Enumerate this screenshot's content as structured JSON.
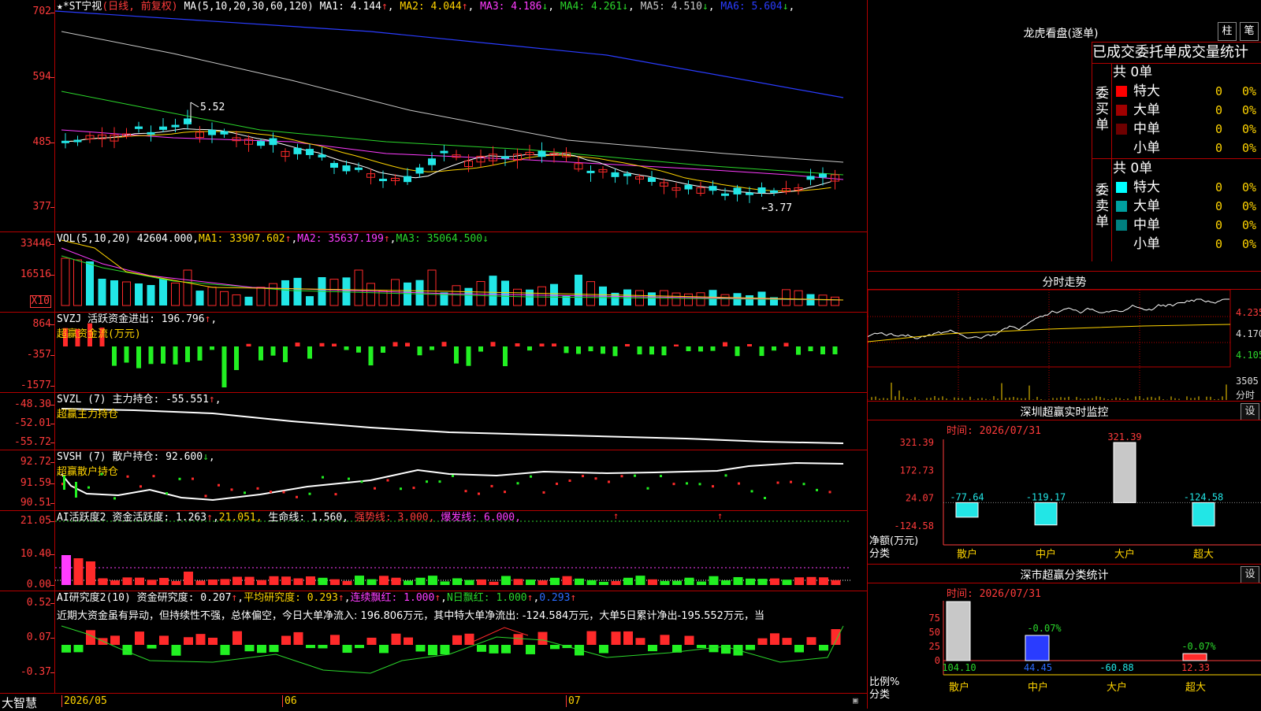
{
  "main": {
    "title_stock": "★*ST宁视",
    "title_mode": "(日线, 前复权)",
    "ma_label": "MA(5,10,20,30,60,120)",
    "ma": [
      {
        "name": "MA1: 4.144",
        "arrow": "↑",
        "color": "#ffffff"
      },
      {
        "name": "MA2: 4.044",
        "arrow": "↑",
        "color": "#ffd400"
      },
      {
        "name": "MA3: 4.186",
        "arrow": "↓",
        "color": "#ff3cff"
      },
      {
        "name": "MA4: 4.261",
        "arrow": "↓",
        "color": "#2bd62b"
      },
      {
        "name": "MA5: 4.510",
        "arrow": "↓",
        "color": "#c8c8c8"
      },
      {
        "name": "MA6: 5.604",
        "arrow": "↓",
        "color": "#2a3cff"
      }
    ],
    "yticks": [
      "702",
      "594",
      "485",
      "377"
    ],
    "high_label": "5.52",
    "low_label": "3.77"
  },
  "volume": {
    "label": "VOL(5,10,20)",
    "value": "42604.000",
    "ma1": "MA1: 33907.602",
    "ma2": "MA2: 35637.199",
    "ma3": "MA3: 35064.500",
    "yticks": [
      "33446",
      "16516"
    ],
    "unit": "X10"
  },
  "svzj": {
    "label": "SVZJ",
    "text": "活跃资金进出: 196.796",
    "subtitle": "超赢资金流(万元)",
    "yticks": [
      "864",
      "-357",
      "-1577"
    ]
  },
  "svzl": {
    "label": "SVZL (7)",
    "text": "主力持仓: -55.551",
    "subtitle": "超赢主力持仓",
    "yticks": [
      "-48.30",
      "-52.01",
      "-55.72"
    ]
  },
  "svsh": {
    "label": "SVSH (7)",
    "text": "散户持仓: 92.600",
    "subtitle": "超赢散户持仓",
    "yticks": [
      "92.72",
      "91.59",
      "90.51"
    ]
  },
  "ai_active": {
    "label": "AI活跃度2",
    "t1": "资金活跃度: 1.263",
    "t2": "21.051,",
    "t3": "生命线: 1.560,",
    "t4": "强势线: 3.000,",
    "t5": "爆发线: 6.000,",
    "yticks": [
      "21.05",
      "10.40",
      "0.00"
    ]
  },
  "ai_research": {
    "label": "AI研究度2(10)",
    "t1": "资金研究度: 0.207",
    "t2": "平均研究度: 0.293",
    "t3": "连续飘红: 1.000",
    "t4": "N日飘红: 1.000",
    "t5": "0.293",
    "comment": "近期大资金虽有异动，但持续性不强，总体偏空，今日大单净流入: 196.806万元，其中特大单净流出: -124.584万元，大单5日累计净出-195.552万元，当",
    "yticks": [
      "0.52",
      "0.07",
      "-0.37"
    ]
  },
  "dates": {
    "logo": "大智慧",
    "labels": [
      "2026/05",
      "06",
      "07"
    ]
  },
  "longhu": {
    "title": "龙虎看盘(逐单)",
    "btn_zhu": "柱",
    "btn_bi": "笔",
    "header": "已成交委托单成交量统计",
    "buy_label": "委买单",
    "sell_label": "委卖单",
    "buy_total": "共 0单",
    "sell_total": "共 0单",
    "buy_rows": [
      {
        "name": "特大",
        "qty": "0",
        "pct": "0%",
        "color": "#ff0000"
      },
      {
        "name": "大单",
        "qty": "0",
        "pct": "0%",
        "color": "#a00000"
      },
      {
        "name": "中单",
        "qty": "0",
        "pct": "0%",
        "color": "#6e0000"
      },
      {
        "name": "小单",
        "qty": "0",
        "pct": "0%",
        "color": ""
      }
    ],
    "sell_rows": [
      {
        "name": "特大",
        "qty": "0",
        "pct": "0%",
        "color": "#00ffff"
      },
      {
        "name": "大单",
        "qty": "0",
        "pct": "0%",
        "color": "#00a0a0"
      },
      {
        "name": "中单",
        "qty": "0",
        "pct": "0%",
        "color": "#008080"
      },
      {
        "name": "小单",
        "qty": "0",
        "pct": "0%",
        "color": ""
      }
    ]
  },
  "intraday": {
    "title": "分时走势",
    "yticks": [
      "4.235",
      "4.170",
      "4.105"
    ],
    "vol_label": "3505",
    "vol_unit": "分时"
  },
  "monitor": {
    "title": "深圳超赢实时监控",
    "gear": "设",
    "time": "时间: 2026/07/31",
    "yticks": [
      "321.39",
      "172.73",
      "24.07",
      "-124.58"
    ],
    "ylabel": "净额(万元)",
    "xlabel": "分类",
    "categories": [
      "散户",
      "中户",
      "大户",
      "超大"
    ],
    "values": [
      "-77.64",
      "-119.17",
      "321.39",
      "-124.58"
    ]
  },
  "classify": {
    "title": "深市超赢分类统计",
    "gear": "设",
    "time": "时间: 2026/07/31",
    "yticks": [
      "75",
      "50",
      "25",
      "0"
    ],
    "ylabel": "比例%",
    "xlabel": "分类",
    "categories": [
      "散户",
      "中户",
      "大户",
      "超大"
    ],
    "pct_labels": [
      "-0.07%",
      "-0.07%"
    ],
    "values": [
      "104.10",
      "44.45",
      "-60.88",
      "12.33"
    ]
  },
  "chart_data": [
    {
      "type": "bar",
      "title": "深圳超赢实时监控",
      "ylabel": "净额(万元)",
      "xlabel": "分类",
      "categories": [
        "散户",
        "中户",
        "大户",
        "超大"
      ],
      "values": [
        -77.64,
        -119.17,
        321.39,
        -124.58
      ],
      "ylim": [
        -124.58,
        321.39
      ]
    },
    {
      "type": "bar",
      "title": "深市超赢分类统计",
      "ylabel": "比例%",
      "xlabel": "分类",
      "categories": [
        "散户",
        "中户",
        "大户",
        "超大"
      ],
      "values": [
        104.1,
        44.45,
        -60.88,
        12.33
      ],
      "ylim": [
        0,
        75
      ]
    }
  ]
}
